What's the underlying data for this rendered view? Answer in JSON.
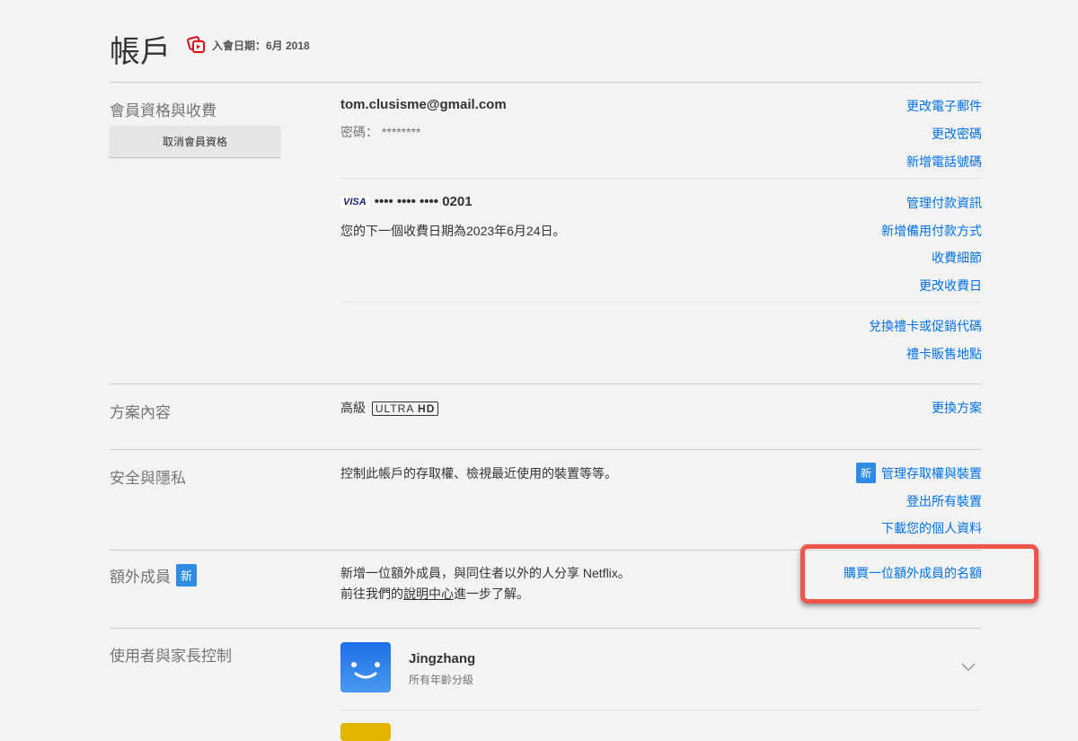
{
  "title": "帳戶",
  "member_since": "入會日期：6月 2018",
  "membership": {
    "section": "會員資格與收費",
    "cancel_button": "取消會員資格",
    "email": "tom.clusisme@gmail.com",
    "password_label": "密碼：",
    "password_value": "********",
    "links1": [
      "更改電子郵件",
      "更改密碼",
      "新增電話號碼"
    ],
    "card_brand": "VISA",
    "card_number": "•••• •••• •••• 0201",
    "next_billing": "您的下一個收費日期為2023年6月24日。",
    "links2": [
      "管理付款資訊",
      "新增備用付款方式",
      "收費細節",
      "更改收費日"
    ],
    "links3": [
      "兌換禮卡或促銷代碼",
      "禮卡販售地點"
    ]
  },
  "plan": {
    "section": "方案內容",
    "name": "高級",
    "badge_ultra": "ULTRA",
    "badge_hd": "HD",
    "link": "更換方案"
  },
  "security": {
    "section": "安全與隱私",
    "desc": "控制此帳戶的存取權、檢視最近使用的裝置等等。",
    "new_badge": "新",
    "links": [
      "管理存取權與裝置",
      "登出所有裝置",
      "下載您的個人資料"
    ]
  },
  "extra": {
    "section": "額外成員",
    "new_badge": "新",
    "line1": "新增一位額外成員，與同住者以外的人分享 Netflix。",
    "line2_pre": "前往我們的",
    "line2_link": "說明中心",
    "line2_post": "進一步了解。",
    "link": "購買一位額外成員的名額"
  },
  "profiles": {
    "section": "使用者與家長控制",
    "items": [
      {
        "name": "Jingzhang",
        "rating": "所有年齡分級"
      }
    ]
  }
}
